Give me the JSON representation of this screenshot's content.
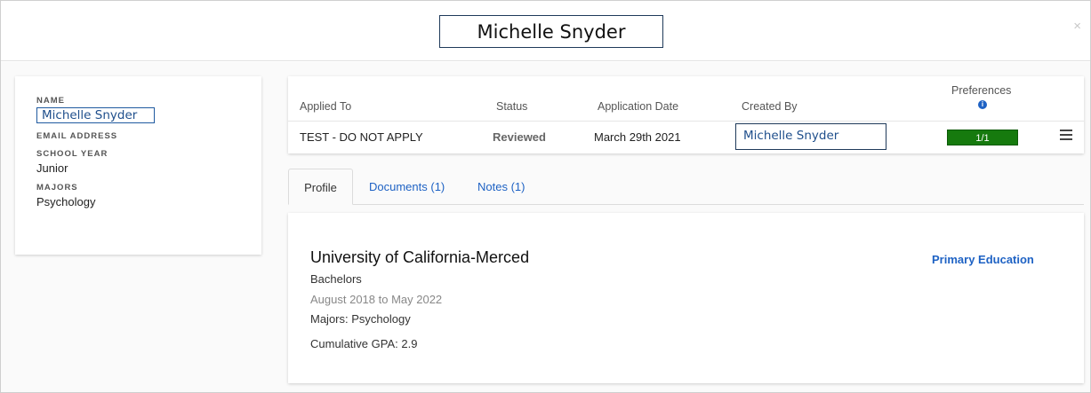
{
  "modal": {
    "title": "Michelle Snyder",
    "close_glyph": "×"
  },
  "student": {
    "name_label": "NAME",
    "name": "Michelle Snyder",
    "email_label": "EMAIL ADDRESS",
    "school_year_label": "SCHOOL YEAR",
    "school_year": "Junior",
    "majors_label": "MAJORS",
    "majors": "Psychology"
  },
  "application": {
    "headers": {
      "applied_to": "Applied To",
      "status": "Status",
      "application_date": "Application Date",
      "created_by": "Created By",
      "preferences": "Preferences"
    },
    "row": {
      "applied_to": "TEST - DO NOT APPLY",
      "status": "Reviewed",
      "application_date": "March 29th 2021",
      "created_by": "Michelle Snyder",
      "preferences": "1/1"
    },
    "info_glyph": "i",
    "accent_green": "#167a0e"
  },
  "tabs": [
    {
      "label": "Profile",
      "active": true
    },
    {
      "label": "Documents (1)",
      "active": false
    },
    {
      "label": "Notes (1)",
      "active": false
    }
  ],
  "profile": {
    "school": "University of California-Merced",
    "tag": "Primary Education",
    "degree": "Bachelors",
    "dates": "August 2018 to May 2022",
    "majors": "Majors: Psychology",
    "gpa": "Cumulative GPA: 2.9"
  },
  "colors": {
    "link_blue": "#1e62c4",
    "border_dark": "#1f3a5a"
  }
}
